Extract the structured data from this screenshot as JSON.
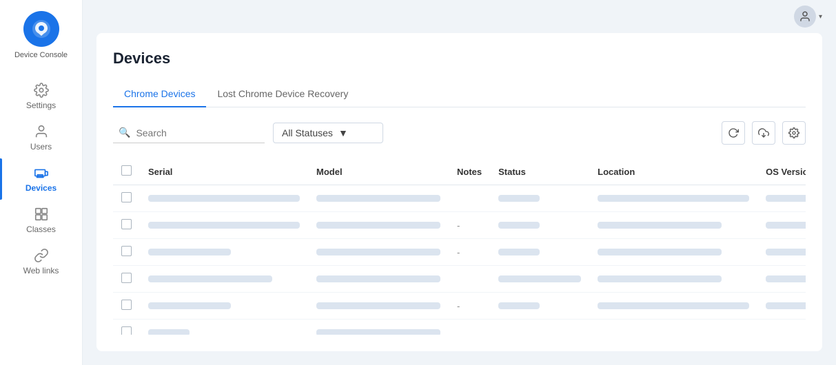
{
  "app": {
    "name": "Device Console"
  },
  "sidebar": {
    "items": [
      {
        "id": "settings",
        "label": "Settings",
        "active": false
      },
      {
        "id": "users",
        "label": "Users",
        "active": false
      },
      {
        "id": "devices",
        "label": "Devices",
        "active": true
      },
      {
        "id": "classes",
        "label": "Classes",
        "active": false
      },
      {
        "id": "weblinks",
        "label": "Web links",
        "active": false
      }
    ]
  },
  "topbar": {
    "chevron": "▾"
  },
  "page": {
    "title": "Devices"
  },
  "tabs": [
    {
      "id": "chrome-devices",
      "label": "Chrome Devices",
      "active": true
    },
    {
      "id": "lost-recovery",
      "label": "Lost Chrome Device Recovery",
      "active": false
    }
  ],
  "toolbar": {
    "search_placeholder": "Search",
    "status_filter": "All Statuses"
  },
  "table": {
    "columns": [
      {
        "id": "serial",
        "label": "Serial"
      },
      {
        "id": "model",
        "label": "Model"
      },
      {
        "id": "notes",
        "label": "Notes"
      },
      {
        "id": "status",
        "label": "Status"
      },
      {
        "id": "location",
        "label": "Location"
      },
      {
        "id": "os_version",
        "label": "OS Version"
      }
    ],
    "rows": [
      {
        "notes": "",
        "hasDash": false
      },
      {
        "notes": "-",
        "hasDash": true
      },
      {
        "notes": "-",
        "hasDash": true
      },
      {
        "notes": "",
        "hasDash": false
      },
      {
        "notes": "-",
        "hasDash": true
      },
      {
        "notes": "",
        "hasDash": false
      }
    ]
  }
}
